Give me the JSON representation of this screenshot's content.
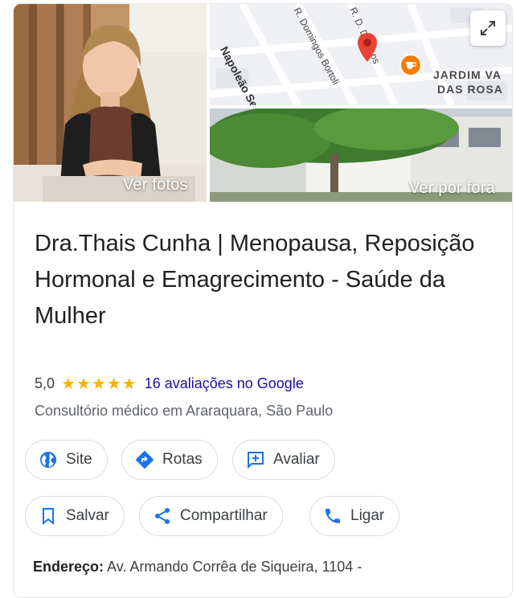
{
  "photos": {
    "view_photos_label": "Ver fotos",
    "view_outside_label": "Ver por fora"
  },
  "map": {
    "streets": [
      "Napoleão Selmi",
      "R. Domingos Bortoli",
      "R. D. De Lops"
    ],
    "neighborhood_line1": "JARDIM VA",
    "neighborhood_line2": "DAS ROSA",
    "expand_icon": "expand-icon",
    "pin_color": "#ea4335",
    "cafe_color": "#f57c00"
  },
  "place": {
    "title": "Dra.Thais Cunha | Menopausa, Reposição Hormonal e Emagrecimento - Saúde da Mulher",
    "rating": "5,0",
    "stars": "★★★★★",
    "reviews": "16 avaliações no Google",
    "category": "Consultório médico em Araraquara, São Paulo"
  },
  "actions": {
    "site": "Site",
    "directions": "Rotas",
    "review": "Avaliar",
    "save": "Salvar",
    "share": "Compartilhar",
    "call": "Ligar"
  },
  "address": {
    "label": "Endereço:",
    "value": "Av. Armando Corrêa de Siqueira, 1104 -"
  },
  "colors": {
    "accent": "#1a73e8",
    "link": "#1a0dab",
    "star": "#f5b400"
  }
}
